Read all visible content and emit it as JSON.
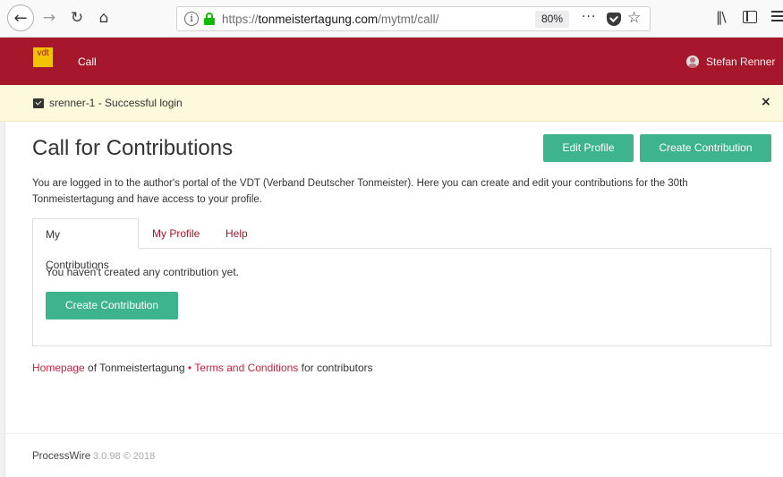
{
  "browser": {
    "back": "←",
    "forward": "→",
    "reload": "↻",
    "home": "⌂",
    "url_prefix": "https://",
    "url_domain": "tonmeistertagung.com",
    "url_path": "/mytmt/call/",
    "zoom": "80%",
    "page_actions": "···",
    "star": "☆",
    "library": "‖\\"
  },
  "header": {
    "logo": "vdt",
    "nav_call": "Call",
    "user_name": "Stefan Renner"
  },
  "alert": {
    "text": "srenner-1 - Successful login",
    "close": "×"
  },
  "main": {
    "title": "Call for Contributions",
    "edit_profile": "Edit Profile",
    "create_contribution": "Create Contribution",
    "intro": "You are logged in to the author's portal of the VDT (Verband Deutscher Tonmeister). Here you can create and edit your contributions for the 30th Tonmeistertagung and have access to your profile.",
    "tabs": [
      {
        "label": "My Contributions"
      },
      {
        "label": "My Profile"
      },
      {
        "label": "Help"
      }
    ],
    "empty_message": "You haven't created any contribution yet.",
    "panel_button": "Create Contribution"
  },
  "links": {
    "homepage": "Homepage",
    "of_text": " of Tonmeistertagung ",
    "bullet": "•",
    "terms": "Terms and Conditions",
    "suffix": " for contributors"
  },
  "footer": {
    "name": "ProcessWire",
    "version": "3.0.98 © 2018"
  },
  "colors": {
    "brand": "#a6172b",
    "accent_button": "#3eb48e",
    "alert_bg": "#fcf9dc",
    "link": "#c5233d"
  }
}
